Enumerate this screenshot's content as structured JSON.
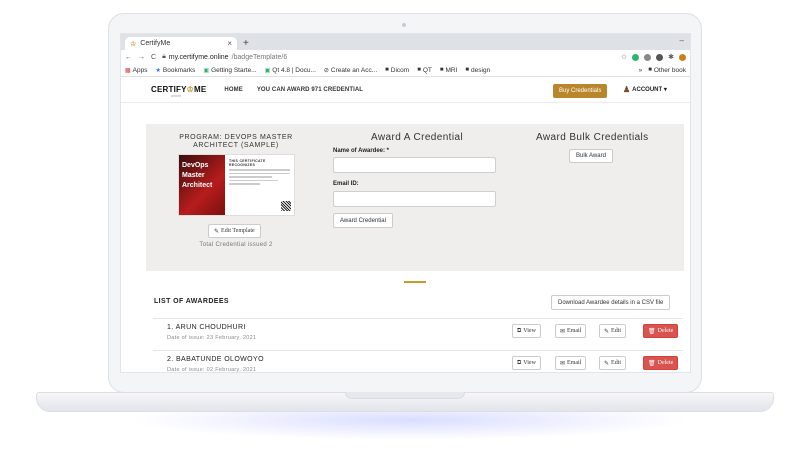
{
  "browser": {
    "tab_title": "CertifyMe",
    "tab_close": "×",
    "new_tab": "+",
    "minimize": "–",
    "url_host": "my.certifyme.online",
    "url_path": "/badgeTemplate/6",
    "bookmarks": [
      {
        "label": "Apps",
        "icon": "apps-grid-icon"
      },
      {
        "label": "Bookmarks",
        "icon": "star-icon"
      },
      {
        "label": "Getting Starte...",
        "icon": "green-sheet-icon"
      },
      {
        "label": "Qt 4.8 | Docu...",
        "icon": "green-sheet-icon"
      },
      {
        "label": "Create an Acc...",
        "icon": "globe-icon"
      },
      {
        "label": "Dicom",
        "icon": "folder-icon"
      },
      {
        "label": "QT",
        "icon": "folder-icon"
      },
      {
        "label": "MRI",
        "icon": "folder-icon"
      },
      {
        "label": "design",
        "icon": "folder-icon"
      }
    ],
    "more_bookmarks": "»",
    "other_bookmarks": "Other book"
  },
  "nav": {
    "brand_left": "CERTIFY",
    "brand_o": "♔",
    "brand_right": "ME",
    "brand_sub": "online",
    "home": "HOME",
    "award_count": "YOU CAN AWARD 971 CREDENTIAL",
    "buy_label": "Buy Credentials",
    "account_label": "ACCOUNT ▾"
  },
  "program": {
    "title": "PROGRAM: DEVOPS MASTER ARCHITECT (SAMPLE)",
    "badge_text": "DevOps Master Architect",
    "badge_cert_title": "THIS CERTIFICATE RECOGNIZES",
    "edit_label": "Edit Template",
    "total": "Total Credential issued 2"
  },
  "award": {
    "title": "Award A Credential",
    "name_label": "Name of Awardee: *",
    "email_label": "Email ID:",
    "button": "Award Credential"
  },
  "bulk": {
    "title": "Award Bulk Credentials",
    "button": "Bulk Award"
  },
  "awardees": {
    "title": "LIST OF AWARDEES",
    "csv_button": "Download Awardee details in a CSV file",
    "view_label": "View",
    "email_label": "Email",
    "edit_label": "Edit",
    "delete_label": "Delete",
    "rows": [
      {
        "name": "1. ARUN CHOUDHURI",
        "date": "Date of issue: 23 February, 2021"
      },
      {
        "name": "2. BABATUNDE OLOWOYO",
        "date": "Date of issue: 02 February, 2021"
      }
    ]
  },
  "colors": {
    "accent": "#b9862b",
    "danger": "#d9534f"
  }
}
